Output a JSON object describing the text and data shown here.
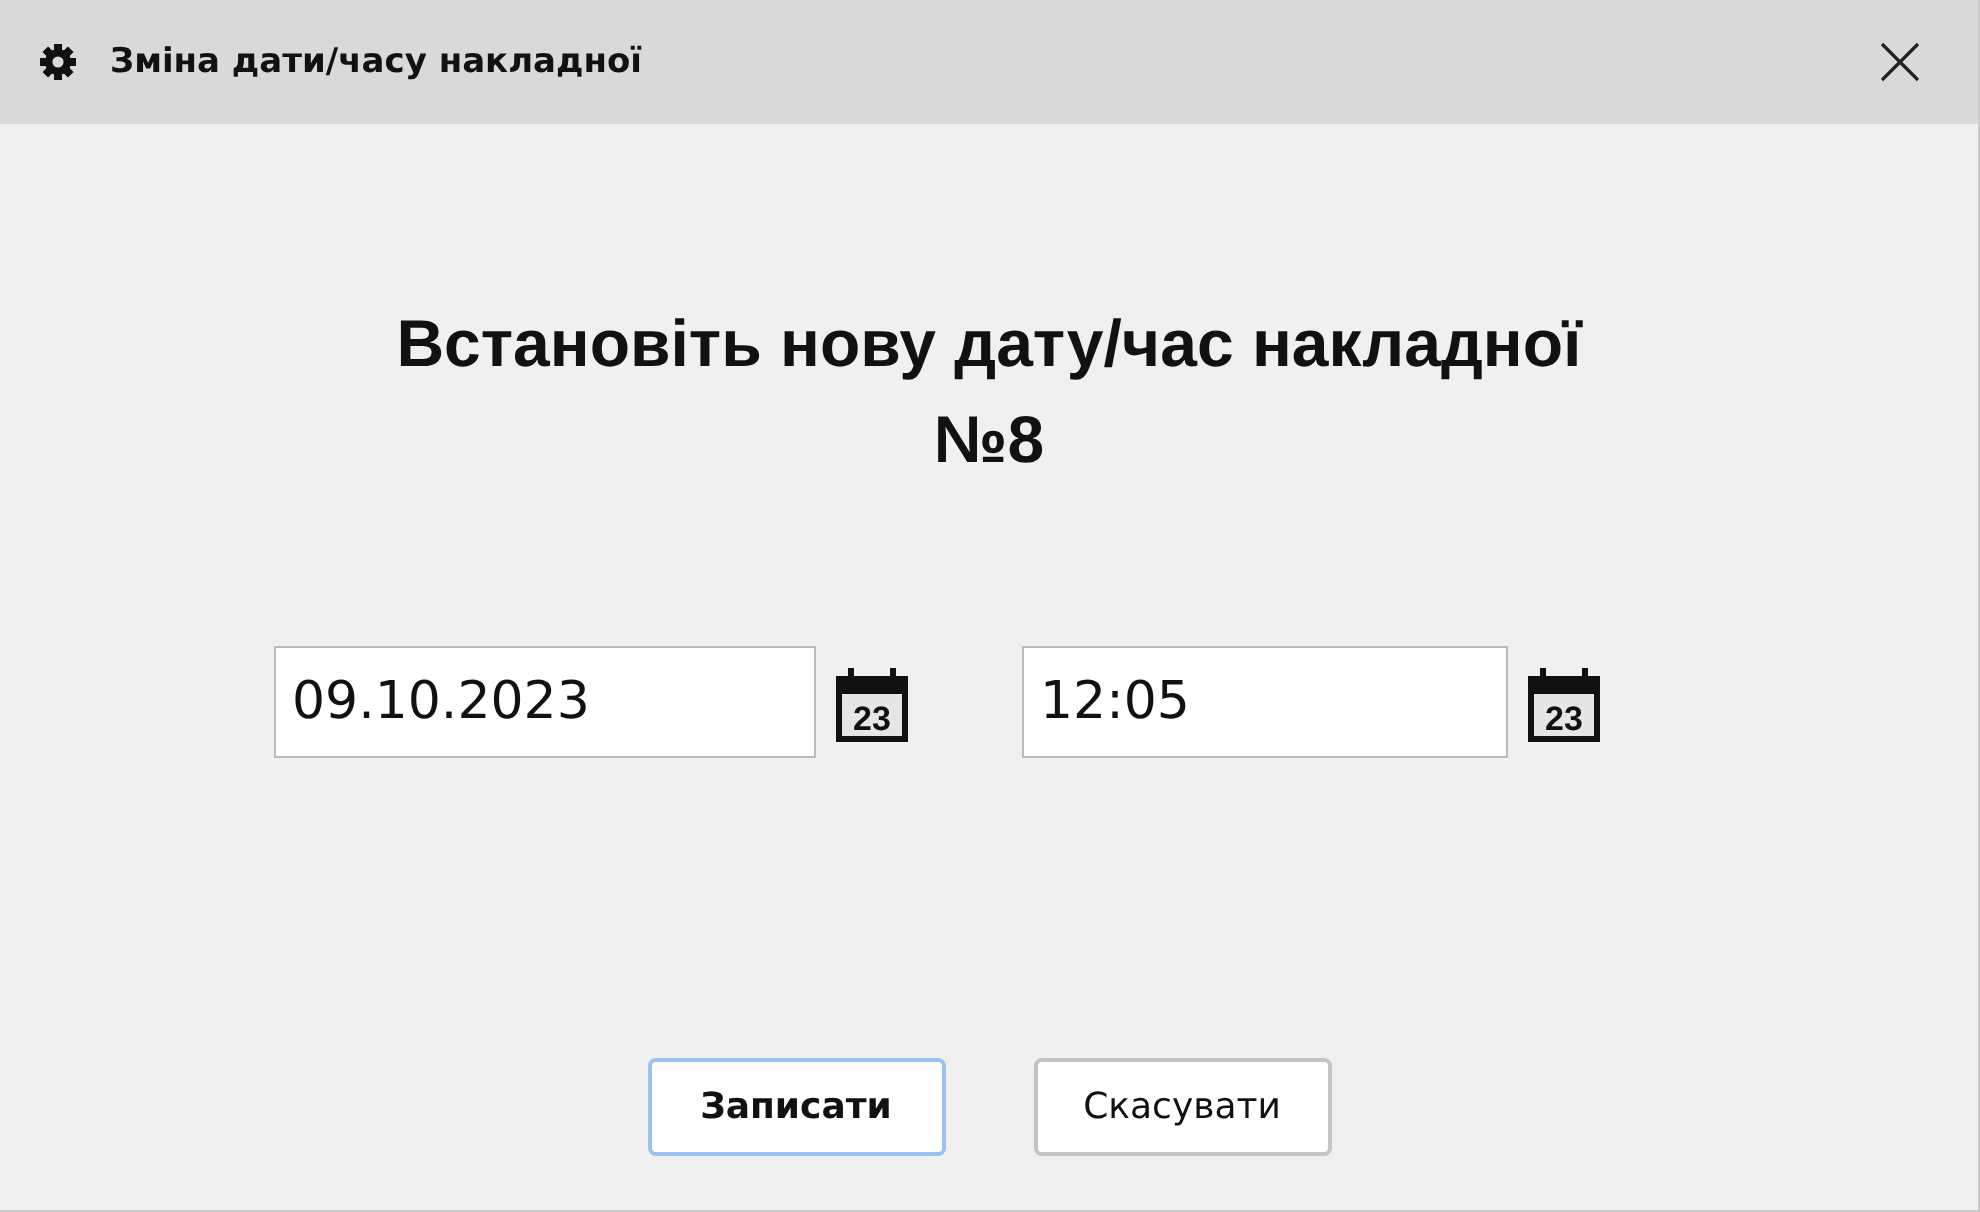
{
  "window": {
    "title": "Зміна дати/часу накладної"
  },
  "heading_lines": [
    "Встановіть нову дату/час накладної",
    "№8"
  ],
  "fields": [
    {
      "value": "09.10.2023",
      "calendar_day": "23"
    },
    {
      "value": "12:05",
      "calendar_day": "23"
    }
  ],
  "buttons": [
    {
      "label": "Записати",
      "default": true
    },
    {
      "label": "Скасувати",
      "default": false
    }
  ]
}
